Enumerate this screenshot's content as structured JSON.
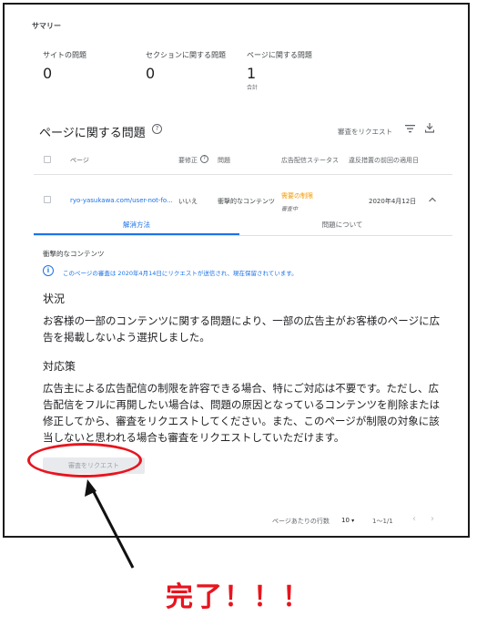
{
  "summary": {
    "heading": "サマリー",
    "cards": [
      {
        "label": "サイトの問題",
        "value": "0",
        "sub": ""
      },
      {
        "label": "セクションに関する問題",
        "value": "0",
        "sub": ""
      },
      {
        "label": "ページに関する問題",
        "value": "1",
        "sub": "合計"
      }
    ]
  },
  "issues": {
    "title": "ページに関する問題",
    "request_review_label": "審査をリクエスト",
    "columns": {
      "page": "ページ",
      "needs_fix": "要修正",
      "issue": "問題",
      "ad_status": "広告配信ステータス",
      "first_date": "違反措置の前回の適用日"
    },
    "row": {
      "page": "ryo-yasukawa.com/user-not-fo...",
      "needs_fix": "いいえ",
      "issue": "衝撃的なコンテンツ",
      "status": "需要の制限",
      "status_sub": "審査中",
      "date": "2020年4月12日"
    },
    "tabs": {
      "resolve": "解消方法",
      "about": "問題について"
    }
  },
  "detail": {
    "category": "衝撃的なコンテンツ",
    "notice": "このページの審査は 2020年4月14日にリクエストが送信され、現在保留されています。",
    "situation_heading": "状況",
    "situation_text": "お客様の一部のコンテンツに関する問題により、一部の広告主がお客様のページに広告を掲載しないよう選択しました。",
    "action_heading": "対応策",
    "action_text": "広告主による広告配信の制限を許容できる場合、特にご対応は不要です。ただし、広告配信をフルに再開したい場合は、問題の原因となっているコンテンツを削除または修正してから、審査をリクエストしてください。また、このページが制限の対象に該当しないと思われる場合も審査をリクエストしていただけます。",
    "request_button": "審査をリクエスト"
  },
  "pagination": {
    "rows_per_page_label": "ページあたりの行数",
    "rows_per_page_value": "10",
    "range": "1〜1/1"
  },
  "annotation": {
    "done_text": "完了！！！"
  },
  "colors": {
    "accent": "#1a73e8",
    "warning": "#f29900",
    "annotation_red": "#e8141e"
  }
}
